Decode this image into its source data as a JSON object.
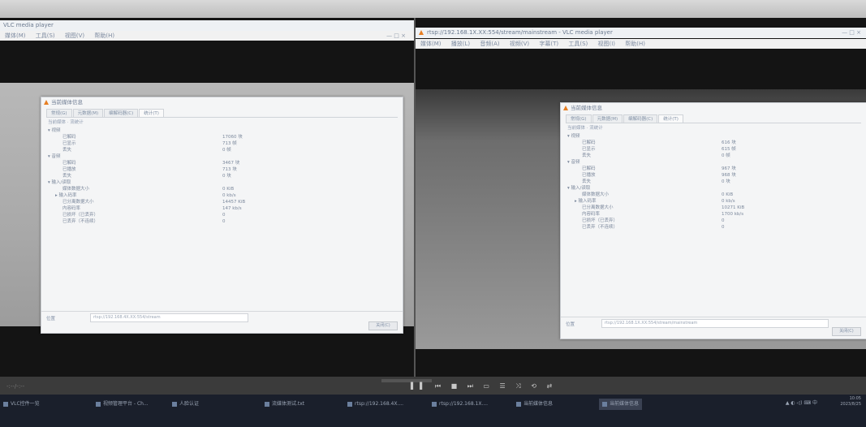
{
  "left_player": {
    "title": "VLC media player",
    "menu": [
      "媒体(M)",
      "工具(S)",
      "视图(V)",
      "帮助(H)"
    ],
    "window_controls": "— □ ×",
    "dialog": {
      "title": "当前媒体信息",
      "tabs": [
        "常规(G)",
        "元数据(M)",
        "编解码器(C)",
        "统计(T)"
      ],
      "subtabs": "当前媒体 · 流统计",
      "rows": [
        {
          "label": "▾ 视频",
          "value": "",
          "indent": 0
        },
        {
          "label": "已解码",
          "value": "17060 块",
          "indent": 2
        },
        {
          "label": "已显示",
          "value": "713 帧",
          "indent": 2
        },
        {
          "label": "丢失",
          "value": "0 帧",
          "indent": 2
        },
        {
          "label": "▾ 音频",
          "value": "",
          "indent": 0
        },
        {
          "label": "已解码",
          "value": "3467 块",
          "indent": 2
        },
        {
          "label": "已播放",
          "value": "713 块",
          "indent": 2
        },
        {
          "label": "丢失",
          "value": "0 块",
          "indent": 2
        },
        {
          "label": "▾ 输入/读取",
          "value": "",
          "indent": 0
        },
        {
          "label": "媒体数据大小",
          "value": "0 KiB",
          "indent": 2
        },
        {
          "label": "▸ 输入码率",
          "value": "0 kb/s",
          "indent": 1
        },
        {
          "label": "已分离数据大小",
          "value": "14457 KiB",
          "indent": 2
        },
        {
          "label": "内容码率",
          "value": "147 kb/s",
          "indent": 2
        },
        {
          "label": "已损坏（已丢弃）",
          "value": "0",
          "indent": 2
        },
        {
          "label": "已丢弃（不连续）",
          "value": "0",
          "indent": 2
        }
      ],
      "footer_label": "位置",
      "footer_value": "rtsp://192.168.4X.XX:554/stream",
      "close_button": "关闭(C)"
    }
  },
  "right_player": {
    "title": "rtsp://192.168.1X.XX:554/stream/mainstream - VLC media player",
    "menu": [
      "媒体(M)",
      "播放(L)",
      "音频(A)",
      "视频(V)",
      "字幕(T)",
      "工具(S)",
      "视图(I)",
      "帮助(H)"
    ],
    "window_controls": "— □ ×",
    "dialog": {
      "title": "当前媒体信息",
      "tabs": [
        "常规(G)",
        "元数据(M)",
        "编解码器(C)",
        "统计(T)"
      ],
      "subtabs": "当前媒体 · 流统计",
      "rows": [
        {
          "label": "▾ 视频",
          "value": "",
          "indent": 0
        },
        {
          "label": "已解码",
          "value": "616 块",
          "indent": 2
        },
        {
          "label": "已显示",
          "value": "615 帧",
          "indent": 2
        },
        {
          "label": "丢失",
          "value": "0 帧",
          "indent": 2
        },
        {
          "label": "▾ 音频",
          "value": "",
          "indent": 0
        },
        {
          "label": "已解码",
          "value": "967 块",
          "indent": 2
        },
        {
          "label": "已播放",
          "value": "968 块",
          "indent": 2
        },
        {
          "label": "丢失",
          "value": "0 块",
          "indent": 2
        },
        {
          "label": "▾ 输入/读取",
          "value": "",
          "indent": 0
        },
        {
          "label": "媒体数据大小",
          "value": "0 KiB",
          "indent": 2
        },
        {
          "label": "▸ 输入码率",
          "value": "0 kb/s",
          "indent": 1
        },
        {
          "label": "已分离数据大小",
          "value": "10271 KiB",
          "indent": 2
        },
        {
          "label": "内容码率",
          "value": "1700 kb/s",
          "indent": 2
        },
        {
          "label": "已损坏（已丢弃）",
          "value": "0",
          "indent": 2
        },
        {
          "label": "已丢弃（不连续）",
          "value": "0",
          "indent": 2
        }
      ],
      "footer_label": "位置",
      "footer_value": "rtsp://192.168.1X.XX:554/stream/mainstream",
      "close_button": "关闭(C)"
    }
  },
  "controls": {
    "left_text": "-:--/-:--",
    "buttons": "▌▌ ⏮ ■ ⏭ ▭ ☰ ⤨ ⟲ ⇄"
  },
  "taskbar": {
    "items": [
      {
        "label": "VLC控件一览",
        "active": false
      },
      {
        "label": "视频管理平台 - Ch...",
        "active": false
      },
      {
        "label": "人脸认证",
        "active": false
      },
      {
        "label": "流媒体测试.txt",
        "active": false
      },
      {
        "label": "rtsp://192.168.4X....",
        "active": false
      },
      {
        "label": "rtsp://192.168.1X....",
        "active": false
      },
      {
        "label": "当前媒体信息",
        "active": false
      },
      {
        "label": "当前媒体信息",
        "active": true
      }
    ],
    "tray": "▲ ◐ ◁) ⌨ 中",
    "time": "10:05",
    "date": "2023/8/25"
  }
}
